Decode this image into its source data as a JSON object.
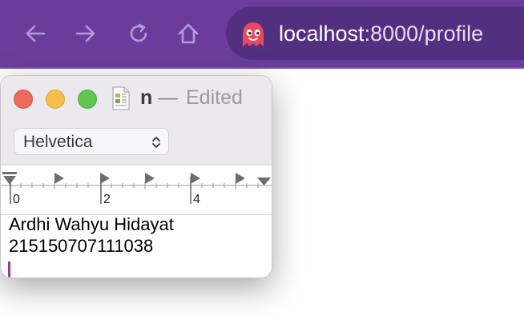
{
  "browser": {
    "url_host": "localhost",
    "url_rest": ":8000/profile",
    "icons": {
      "back": "arrow-left-icon",
      "forward": "arrow-right-icon",
      "reload": "reload-icon",
      "home": "home-icon",
      "site": "ghost-icon"
    },
    "colors": {
      "toolbar": "#6a3d9c",
      "urlbar": "#53307f"
    }
  },
  "window": {
    "title_name": "n",
    "title_dash": "—",
    "title_status": "Edited",
    "font_select": "Helvetica",
    "ruler_labels": [
      "0",
      "2",
      "4"
    ],
    "content_lines": [
      "Ardhi Wahyu Hidayat",
      "215150707111038"
    ],
    "colors": {
      "close": "#ed6a5e",
      "minimize": "#f5bf4f",
      "zoom": "#61c554",
      "caret": "#8e3f9a"
    }
  }
}
